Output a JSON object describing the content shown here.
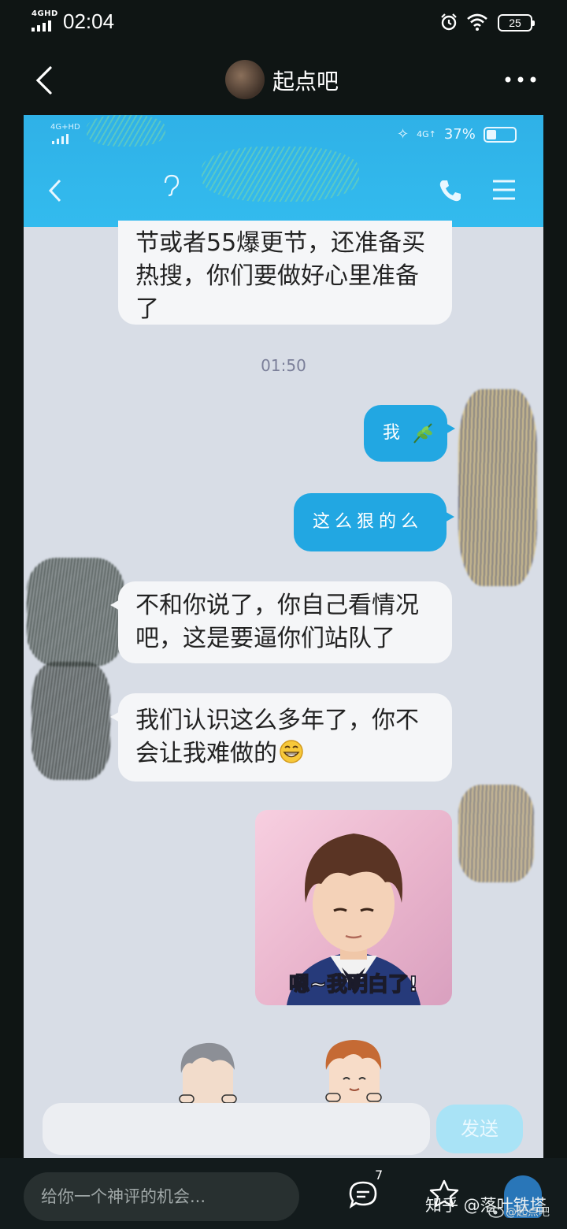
{
  "status_bar": {
    "network": "4GHD",
    "time": "02:04",
    "battery": "25"
  },
  "nav": {
    "title": "起点吧"
  },
  "inner_screenshot": {
    "status": {
      "network": "4G+HD",
      "network2": "4G↑",
      "battery_percent": "37%"
    },
    "messages": [
      {
        "side": "left",
        "text": "节或者55爆更节，还准备买热搜，你们要做好心里准备了"
      },
      {
        "side": "right",
        "text": "我"
      },
      {
        "side": "right",
        "text": "这么狠的么"
      },
      {
        "side": "left",
        "text": "不和你说了，你自己看情况吧，这是要逼你们站队了"
      },
      {
        "side": "left",
        "text": "我们认识这么多年了，你不会让我难做的"
      }
    ],
    "timestamp": "01:50",
    "sticker_caption": "嗯~我明白了!",
    "send_label": "发送"
  },
  "comment_bar": {
    "placeholder": "给你一个神评的机会...",
    "comment_count": "7",
    "watermark": "知乎 @落叶铁塔",
    "watermark2": "@起点吧"
  }
}
